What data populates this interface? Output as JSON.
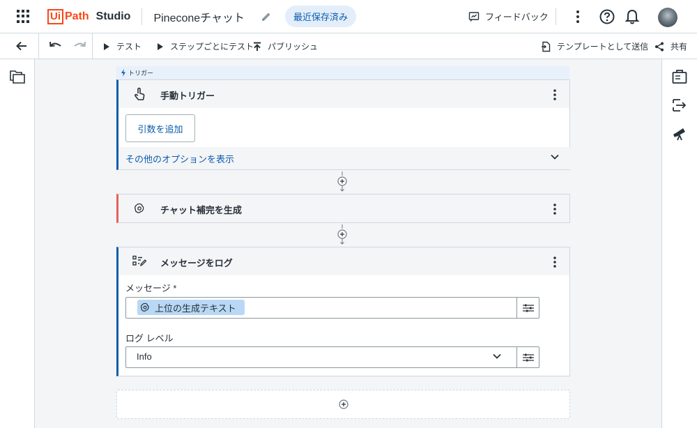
{
  "header": {
    "logo_ui": "Ui",
    "logo_path": "Path",
    "logo_studio": "Studio",
    "project_name": "Pineconeチャット",
    "save_status": "最近保存済み",
    "feedback_label": "フィードバック"
  },
  "toolbar": {
    "test_label": "テスト",
    "step_test_label": "ステップごとにテスト",
    "publish_label": "パブリッシュ",
    "template_label": "テンプレートとして送信",
    "share_label": "共有"
  },
  "trigger_section": {
    "label": "トリガー"
  },
  "cards": {
    "manual_trigger": {
      "title": "手動トリガー",
      "add_argument": "引数を追加",
      "more_options": "その他のオプションを表示"
    },
    "chat_completion": {
      "title": "チャット補完を生成"
    },
    "log_message": {
      "title": "メッセージをログ",
      "message_label": "メッセージ *",
      "message_chip": "上位の生成テキスト",
      "level_label": "ログ レベル",
      "level_value": "Info"
    }
  },
  "colors": {
    "accent_blue": "#0b5cad",
    "brand_orange": "#fa4616",
    "openai_card_border": "#e5625a",
    "chip_bg": "#b8d8f5"
  }
}
